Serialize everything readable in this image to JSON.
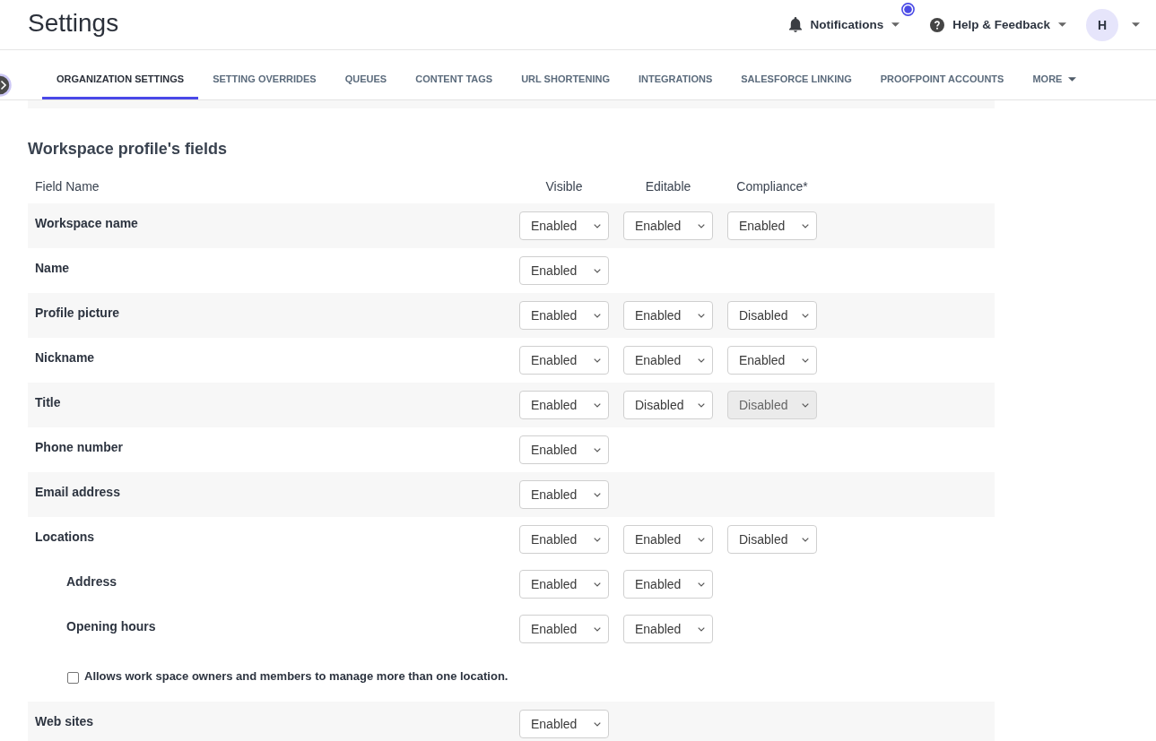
{
  "header": {
    "title": "Settings",
    "notifications": {
      "label": "Notifications",
      "unread": true
    },
    "help": {
      "label": "Help & Feedback"
    },
    "avatar": {
      "initial": "H"
    }
  },
  "tabs": [
    {
      "label": "ORGANIZATION SETTINGS",
      "kind": "tab",
      "selected": true
    },
    {
      "label": "SETTING OVERRIDES",
      "kind": "tab",
      "selected": false
    },
    {
      "label": "QUEUES",
      "kind": "tab",
      "selected": false
    },
    {
      "label": "CONTENT TAGS",
      "kind": "tab",
      "selected": false
    },
    {
      "label": "URL SHORTENING",
      "kind": "tab",
      "selected": false
    },
    {
      "label": "INTEGRATIONS",
      "kind": "tab",
      "selected": false
    },
    {
      "label": "SALESFORCE LINKING",
      "kind": "tab",
      "selected": false
    },
    {
      "label": "PROOFPOINT ACCOUNTS",
      "kind": "tab",
      "selected": false
    },
    {
      "label": "MORE",
      "kind": "menu",
      "selected": false
    }
  ],
  "section": {
    "title": "Workspace profile's fields",
    "columns": [
      "Field Name",
      "Visible",
      "Editable",
      "Compliance*"
    ],
    "fields": [
      {
        "name": "Workspace name",
        "settings": [
          {
            "value": "Enabled",
            "disabled": false
          },
          {
            "value": "Enabled",
            "disabled": false
          },
          {
            "value": "Enabled",
            "disabled": false
          }
        ]
      },
      {
        "name": "Name",
        "settings": [
          {
            "value": "Enabled",
            "disabled": false
          }
        ]
      },
      {
        "name": "Profile picture",
        "settings": [
          {
            "value": "Enabled",
            "disabled": false
          },
          {
            "value": "Enabled",
            "disabled": false
          },
          {
            "value": "Disabled",
            "disabled": false
          }
        ]
      },
      {
        "name": "Nickname",
        "settings": [
          {
            "value": "Enabled",
            "disabled": false
          },
          {
            "value": "Enabled",
            "disabled": false
          },
          {
            "value": "Enabled",
            "disabled": false
          }
        ]
      },
      {
        "name": "Title",
        "settings": [
          {
            "value": "Enabled",
            "disabled": false
          },
          {
            "value": "Disabled",
            "disabled": false
          },
          {
            "value": "Disabled",
            "disabled": true
          }
        ]
      },
      {
        "name": "Phone number",
        "settings": [
          {
            "value": "Enabled",
            "disabled": false
          }
        ]
      },
      {
        "name": "Email address",
        "settings": [
          {
            "value": "Enabled",
            "disabled": false
          }
        ]
      },
      {
        "name": "Locations",
        "settings": [
          {
            "value": "Enabled",
            "disabled": false
          },
          {
            "value": "Enabled",
            "disabled": false
          },
          {
            "value": "Disabled",
            "disabled": false
          }
        ],
        "children": [
          {
            "name": "Address",
            "settings": [
              {
                "value": "Enabled",
                "disabled": false
              },
              {
                "value": "Enabled",
                "disabled": false
              }
            ]
          },
          {
            "name": "Opening hours",
            "settings": [
              {
                "value": "Enabled",
                "disabled": false
              },
              {
                "value": "Enabled",
                "disabled": false
              }
            ]
          }
        ],
        "option": {
          "label": "Allows work space owners and members to manage more than one location.",
          "checked": false
        }
      },
      {
        "name": "Web sites",
        "settings": [
          {
            "value": "Enabled",
            "disabled": false
          }
        ]
      }
    ]
  }
}
